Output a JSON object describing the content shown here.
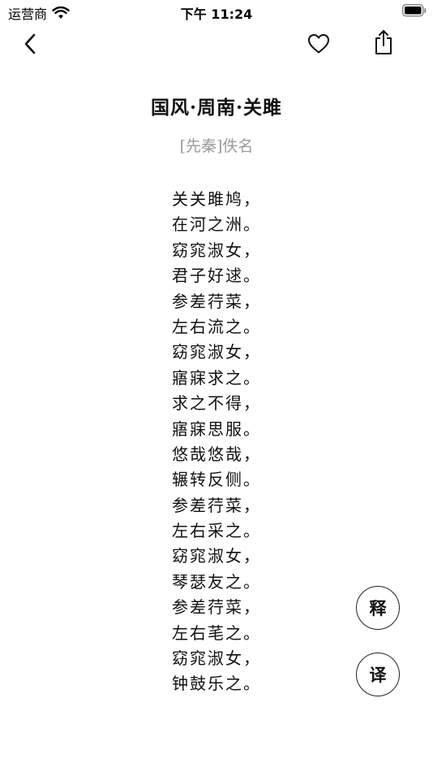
{
  "status_bar": {
    "carrier": "运营商",
    "time": "下午 11:24"
  },
  "nav": {
    "back_icon": "chevron-left-icon",
    "favorite_icon": "heart-icon",
    "share_icon": "share-icon"
  },
  "poem": {
    "title": "国风·周南·关雎",
    "author": "[先秦]佚名",
    "lines": [
      "关关雎鸠，",
      "在河之洲。",
      "窈窕淑女，",
      "君子好逑。",
      "参差荇菜，",
      "左右流之。",
      "窈窕淑女，",
      "寤寐求之。",
      "求之不得，",
      "寤寐思服。",
      "悠哉悠哉，",
      "辗转反侧。",
      "参差荇菜，",
      "左右采之。",
      "窈窕淑女，",
      "琴瑟友之。",
      "参差荇菜，",
      "左右芼之。",
      "窈窕淑女，",
      "钟鼓乐之。"
    ]
  },
  "actions": {
    "annotation_label": "释",
    "translation_label": "译"
  }
}
